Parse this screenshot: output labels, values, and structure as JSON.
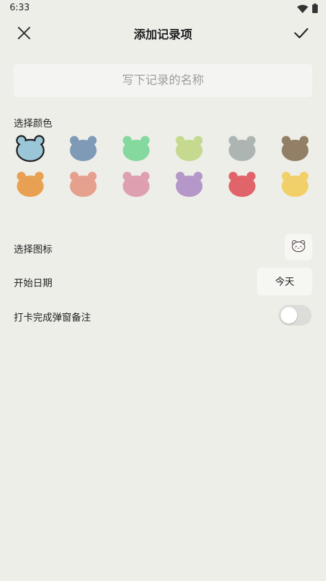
{
  "status_bar": {
    "time": "6:33",
    "icons": [
      "wifi-icon",
      "battery-icon"
    ]
  },
  "header": {
    "title": "添加记录项",
    "close_icon": "close-icon",
    "confirm_icon": "check-icon"
  },
  "name_field": {
    "value": "",
    "placeholder": "写下记录的名称"
  },
  "color_section": {
    "label": "选择颜色",
    "selected_index": 0,
    "colors": [
      "#9AC6D8",
      "#7F9AB7",
      "#85D89E",
      "#C5DA8F",
      "#ADB5B3",
      "#927F66",
      "#E8A152",
      "#E6A08E",
      "#DE9FB1",
      "#B597CA",
      "#E06469",
      "#F1D06A"
    ]
  },
  "icon_row": {
    "label": "选择图标",
    "icon": "bear-face-icon"
  },
  "date_row": {
    "label": "开始日期",
    "value": "今天"
  },
  "popup_row": {
    "label": "打卡完成弹窗备注",
    "enabled": false
  }
}
